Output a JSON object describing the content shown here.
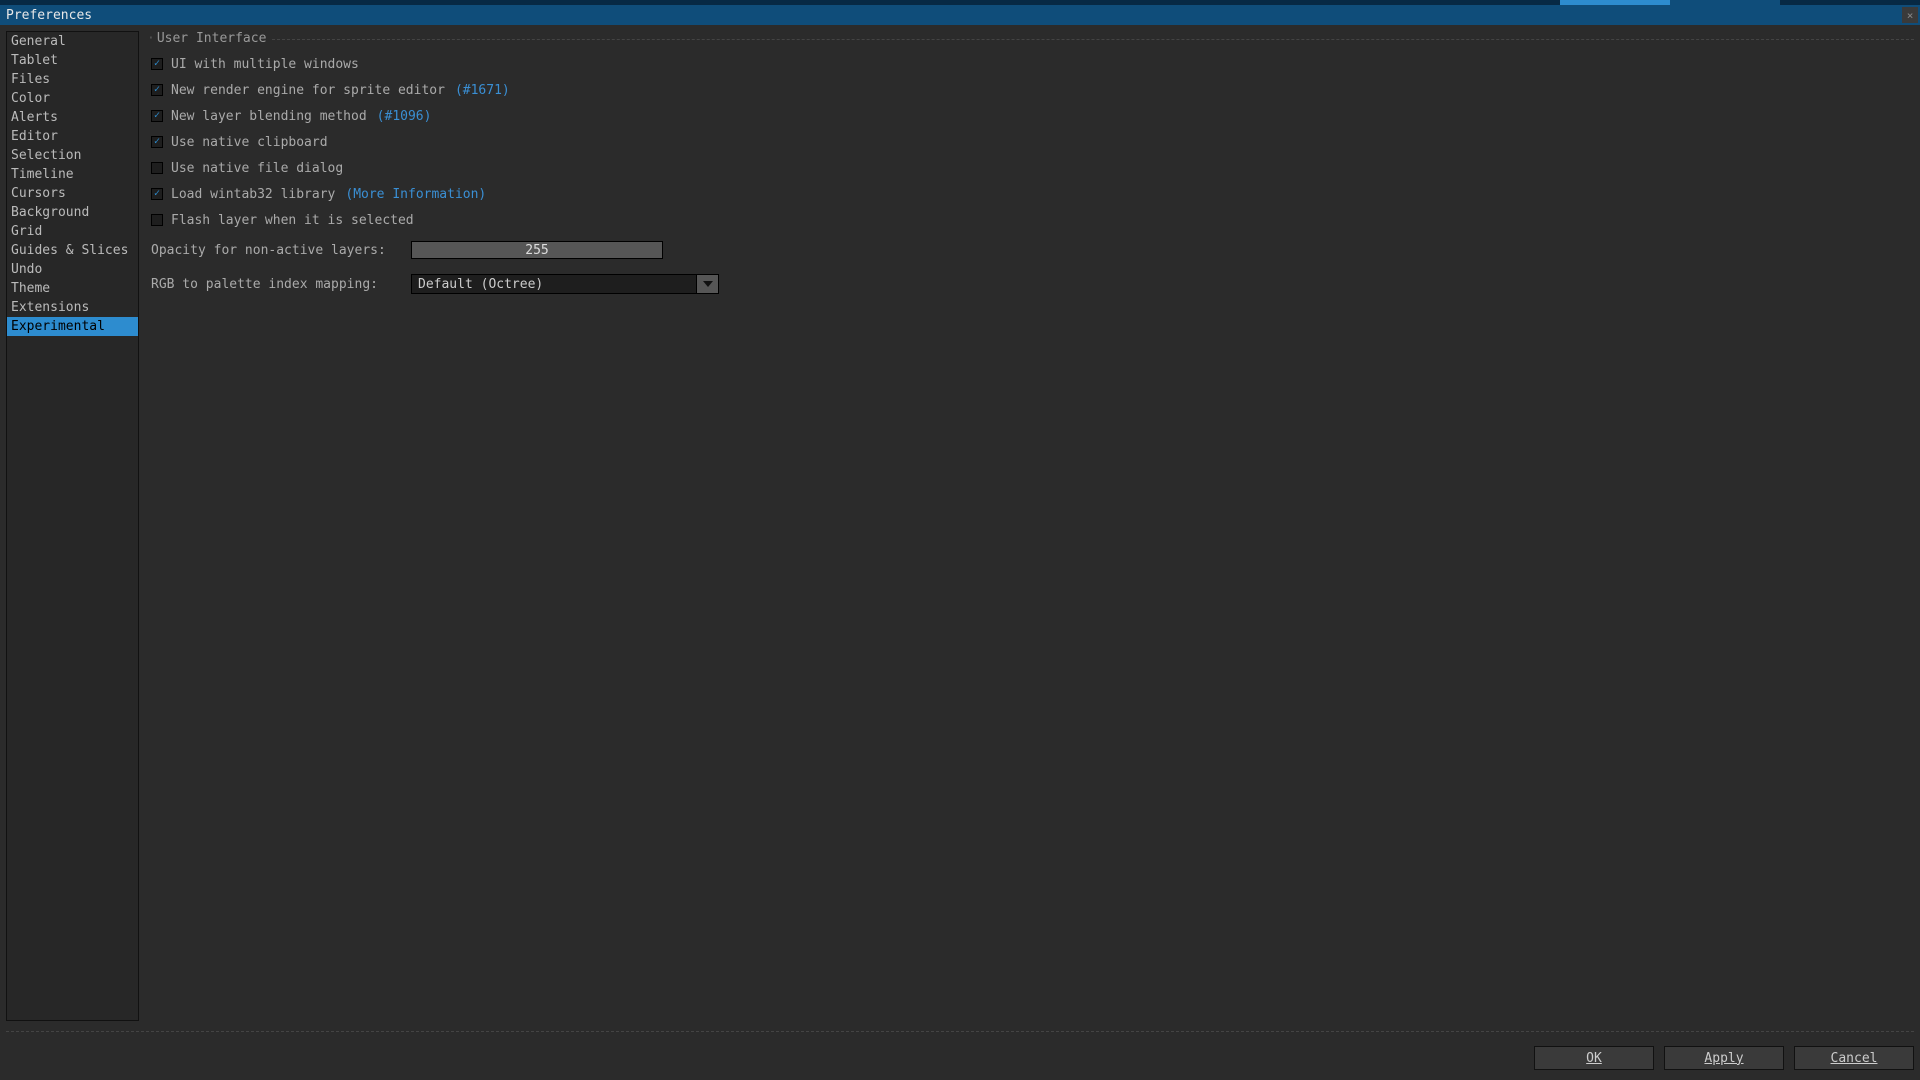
{
  "window": {
    "title": "Preferences"
  },
  "sidebar": {
    "items": [
      "General",
      "Tablet",
      "Files",
      "Color",
      "Alerts",
      "Editor",
      "Selection",
      "Timeline",
      "Cursors",
      "Background",
      "Grid",
      "Guides & Slices",
      "Undo",
      "Theme",
      "Extensions",
      "Experimental"
    ],
    "selected_index": 15
  },
  "section": {
    "title": "User Interface"
  },
  "options": {
    "multi_windows": {
      "label": "UI with multiple windows",
      "checked": true
    },
    "new_render": {
      "label": "New render engine for sprite editor",
      "link": "(#1671)",
      "checked": true
    },
    "new_blending": {
      "label": "New layer blending method",
      "link": "(#1096)",
      "checked": true
    },
    "native_clipboard": {
      "label": "Use native clipboard",
      "checked": true
    },
    "native_filedlg": {
      "label": "Use native file dialog",
      "checked": false
    },
    "wintab": {
      "label": "Load wintab32 library",
      "link": "(More Information)",
      "checked": true
    },
    "flash_layer": {
      "label": "Flash layer when it is selected",
      "checked": false
    }
  },
  "opacity_row": {
    "label": "Opacity for non-active layers:",
    "value": "255"
  },
  "mapping_row": {
    "label": "RGB to palette index mapping:",
    "value": "Default (Octree)"
  },
  "buttons": {
    "ok": "OK",
    "apply": "Apply",
    "cancel": "Cancel"
  }
}
